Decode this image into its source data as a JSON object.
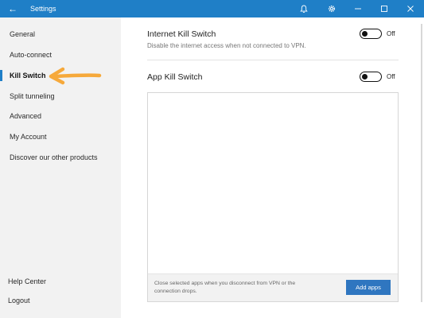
{
  "titlebar": {
    "back_icon": "arrow-left-icon",
    "title": "Settings",
    "icons": [
      "bell-icon",
      "gear-icon",
      "minimize-icon",
      "maximize-icon",
      "close-icon"
    ],
    "color": "#1f7fc7"
  },
  "sidebar": {
    "items": [
      {
        "label": "General"
      },
      {
        "label": "Auto-connect"
      },
      {
        "label": "Kill Switch",
        "active": true
      },
      {
        "label": "Split tunneling"
      },
      {
        "label": "Advanced"
      },
      {
        "label": "My Account"
      },
      {
        "label": "Discover our other products"
      }
    ],
    "bottom_items": [
      {
        "label": "Help Center"
      },
      {
        "label": "Logout"
      }
    ],
    "annotation": "orange-arrow-icon"
  },
  "main": {
    "internet_kill_switch": {
      "title": "Internet Kill Switch",
      "description": "Disable the internet access when not connected to VPN.",
      "state": "Off"
    },
    "app_kill_switch": {
      "title": "App Kill Switch",
      "state": "Off"
    },
    "app_list": {
      "footer_text": "Close selected apps when you disconnect from VPN or the connection drops.",
      "add_button": "Add apps"
    }
  },
  "colors": {
    "accent": "#1f7fc7",
    "button": "#2f76c0",
    "arrow": "#f6a93b",
    "sidebar_bg": "#f2f2f2"
  }
}
